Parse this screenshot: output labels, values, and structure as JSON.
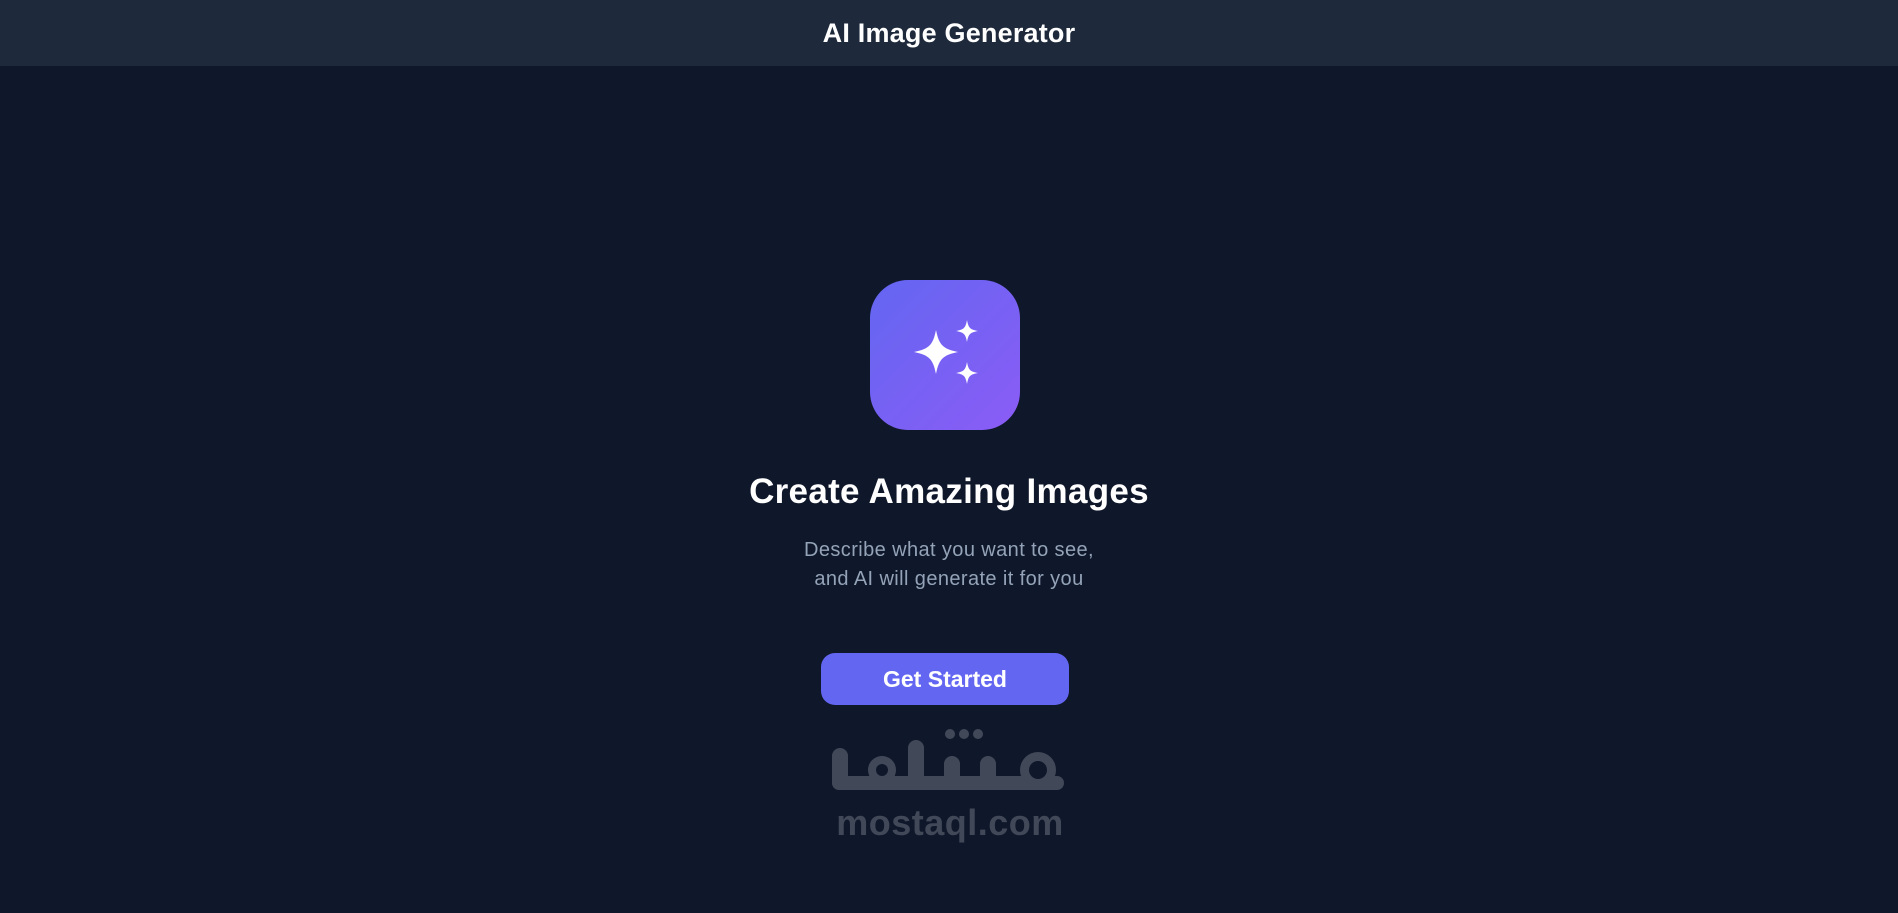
{
  "header": {
    "title": "AI Image Generator"
  },
  "hero": {
    "icon": "sparkles-icon",
    "heading": "Create Amazing Images",
    "subtitle_lines": [
      "Describe what you want to see,",
      "and AI will generate it for you"
    ],
    "cta_label": "Get Started"
  },
  "watermark": {
    "latin_text": "mostaql.com"
  },
  "colors": {
    "background": "#0f172a",
    "header_background": "#1e293b",
    "accent": "#6366f1",
    "accent_secondary": "#8b5cf6",
    "subtitle_text": "#94a3b8"
  }
}
